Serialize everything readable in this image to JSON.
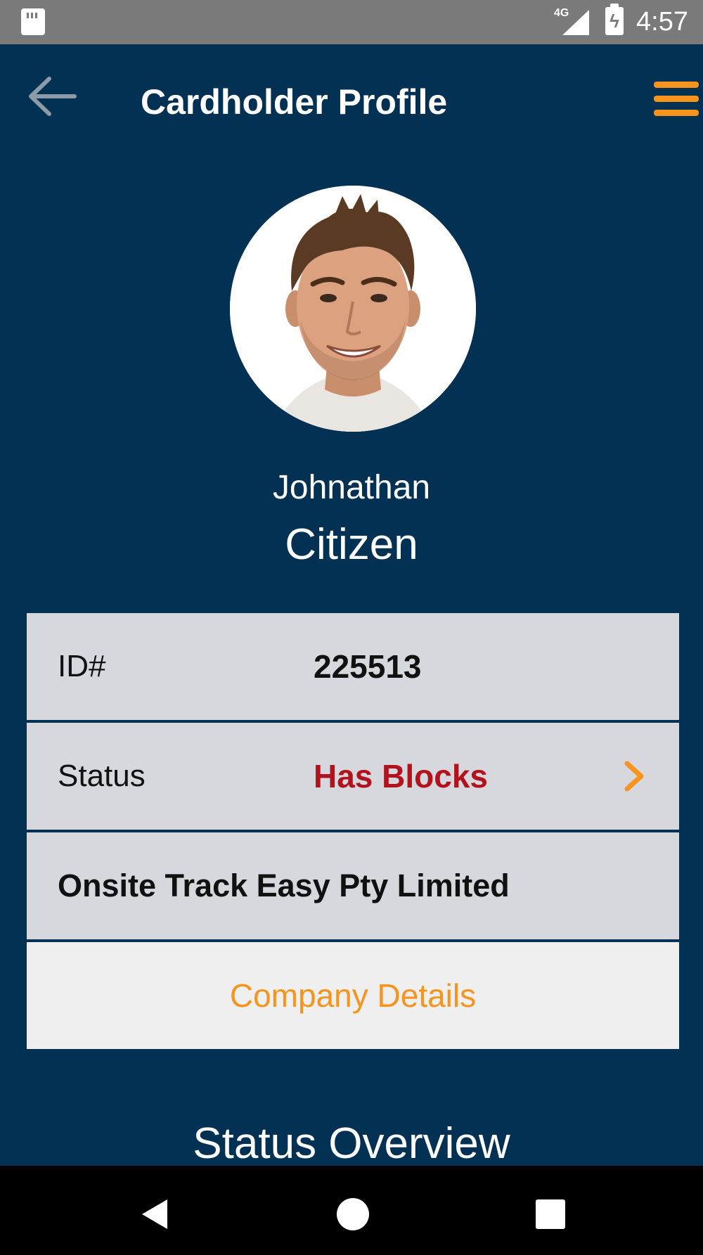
{
  "status_bar": {
    "network": "4G",
    "time": "4:57"
  },
  "header": {
    "title": "Cardholder Profile",
    "back_icon": "arrow-left-icon",
    "menu_icon": "hamburger-menu-icon"
  },
  "profile": {
    "first_name": "Johnathan",
    "last_name": "Citizen"
  },
  "info": {
    "id_label": "ID#",
    "id_value": "225513",
    "status_label": "Status",
    "status_value": "Has Blocks",
    "company_name": "Onsite Track Easy Pty Limited",
    "company_details_link": "Company Details"
  },
  "section": {
    "title": "Status Overview"
  },
  "colors": {
    "background": "#033153",
    "accent": "#f7941d",
    "alert": "#b3111c",
    "row_background": "#d6d8dd"
  }
}
